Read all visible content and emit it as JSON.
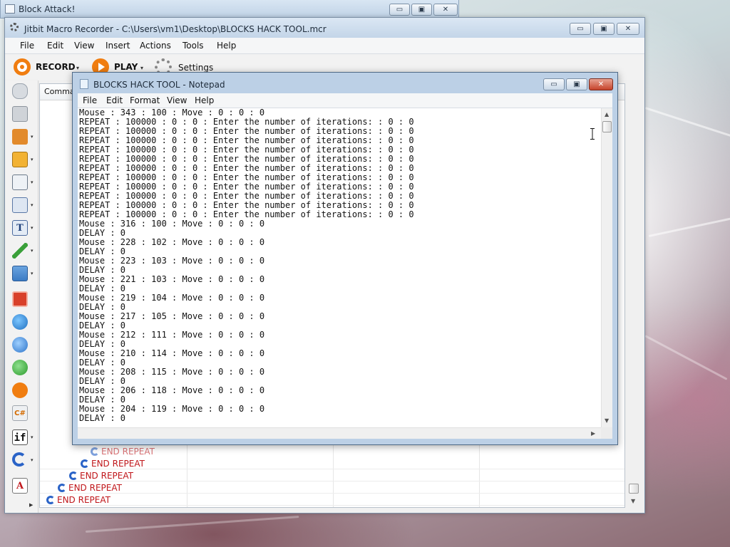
{
  "block_attack": {
    "title": "Block Attack!"
  },
  "jitbit": {
    "title": "Jitbit Macro Recorder - C:\\Users\\vm1\\Desktop\\BLOCKS HACK TOOL.mcr",
    "menu": [
      "File",
      "Edit",
      "View",
      "Insert",
      "Actions",
      "Tools",
      "Help"
    ],
    "toolbar": {
      "record_label": "RECORD",
      "play_label": "PLAY",
      "settings_label": "Settings"
    },
    "grid": {
      "column_header": "Comman",
      "end_rows": [
        "END REPEAT",
        "END REPEAT",
        "END REPEAT",
        "END REPEAT",
        "END REPEAT"
      ]
    },
    "sidebar_icons": [
      "mouse-icon",
      "keyboard-icon",
      "hourglass-icon",
      "print-icon",
      "window-icon",
      "copy-icon",
      "text-icon",
      "eyedropper-icon",
      "image-icon",
      "stop-icon",
      "globe-icon",
      "info-icon",
      "upload-icon",
      "play-icon",
      "csharp-icon",
      "if-icon",
      "repeat-icon",
      "font-icon"
    ],
    "sidebar_labels": {
      "csharp": "C#",
      "if": "if",
      "text": "T",
      "font": "A"
    }
  },
  "notepad": {
    "title": "BLOCKS HACK TOOL - Notepad",
    "menu": [
      "File",
      "Edit",
      "Format",
      "View",
      "Help"
    ],
    "lines": [
      "Mouse : 343 : 100 : Move : 0 : 0 : 0",
      "REPEAT : 100000 : 0 : 0 : Enter the number of iterations: : 0 : 0",
      "REPEAT : 100000 : 0 : 0 : Enter the number of iterations: : 0 : 0",
      "REPEAT : 100000 : 0 : 0 : Enter the number of iterations: : 0 : 0",
      "REPEAT : 100000 : 0 : 0 : Enter the number of iterations: : 0 : 0",
      "REPEAT : 100000 : 0 : 0 : Enter the number of iterations: : 0 : 0",
      "REPEAT : 100000 : 0 : 0 : Enter the number of iterations: : 0 : 0",
      "REPEAT : 100000 : 0 : 0 : Enter the number of iterations: : 0 : 0",
      "REPEAT : 100000 : 0 : 0 : Enter the number of iterations: : 0 : 0",
      "REPEAT : 100000 : 0 : 0 : Enter the number of iterations: : 0 : 0",
      "REPEAT : 100000 : 0 : 0 : Enter the number of iterations: : 0 : 0",
      "REPEAT : 100000 : 0 : 0 : Enter the number of iterations: : 0 : 0",
      "Mouse : 316 : 100 : Move : 0 : 0 : 0",
      "DELAY : 0",
      "Mouse : 228 : 102 : Move : 0 : 0 : 0",
      "DELAY : 0",
      "Mouse : 223 : 103 : Move : 0 : 0 : 0",
      "DELAY : 0",
      "Mouse : 221 : 103 : Move : 0 : 0 : 0",
      "DELAY : 0",
      "Mouse : 219 : 104 : Move : 0 : 0 : 0",
      "DELAY : 0",
      "Mouse : 217 : 105 : Move : 0 : 0 : 0",
      "DELAY : 0",
      "Mouse : 212 : 111 : Move : 0 : 0 : 0",
      "DELAY : 0",
      "Mouse : 210 : 114 : Move : 0 : 0 : 0",
      "DELAY : 0",
      "Mouse : 208 : 115 : Move : 0 : 0 : 0",
      "DELAY : 0",
      "Mouse : 206 : 118 : Move : 0 : 0 : 0",
      "DELAY : 0",
      "Mouse : 204 : 119 : Move : 0 : 0 : 0",
      "DELAY : 0"
    ]
  },
  "caption_buttons": {
    "minimize": "▭",
    "maximize": "▣",
    "close": "✕"
  },
  "scroll_glyphs": {
    "up": "▲",
    "down": "▼",
    "left": "◀",
    "right": "▶",
    "dropdown": "▾"
  },
  "colors": {
    "end_repeat_text": "#c0161a",
    "record_orange": "#f07d10",
    "close_red": "#c6432b"
  }
}
